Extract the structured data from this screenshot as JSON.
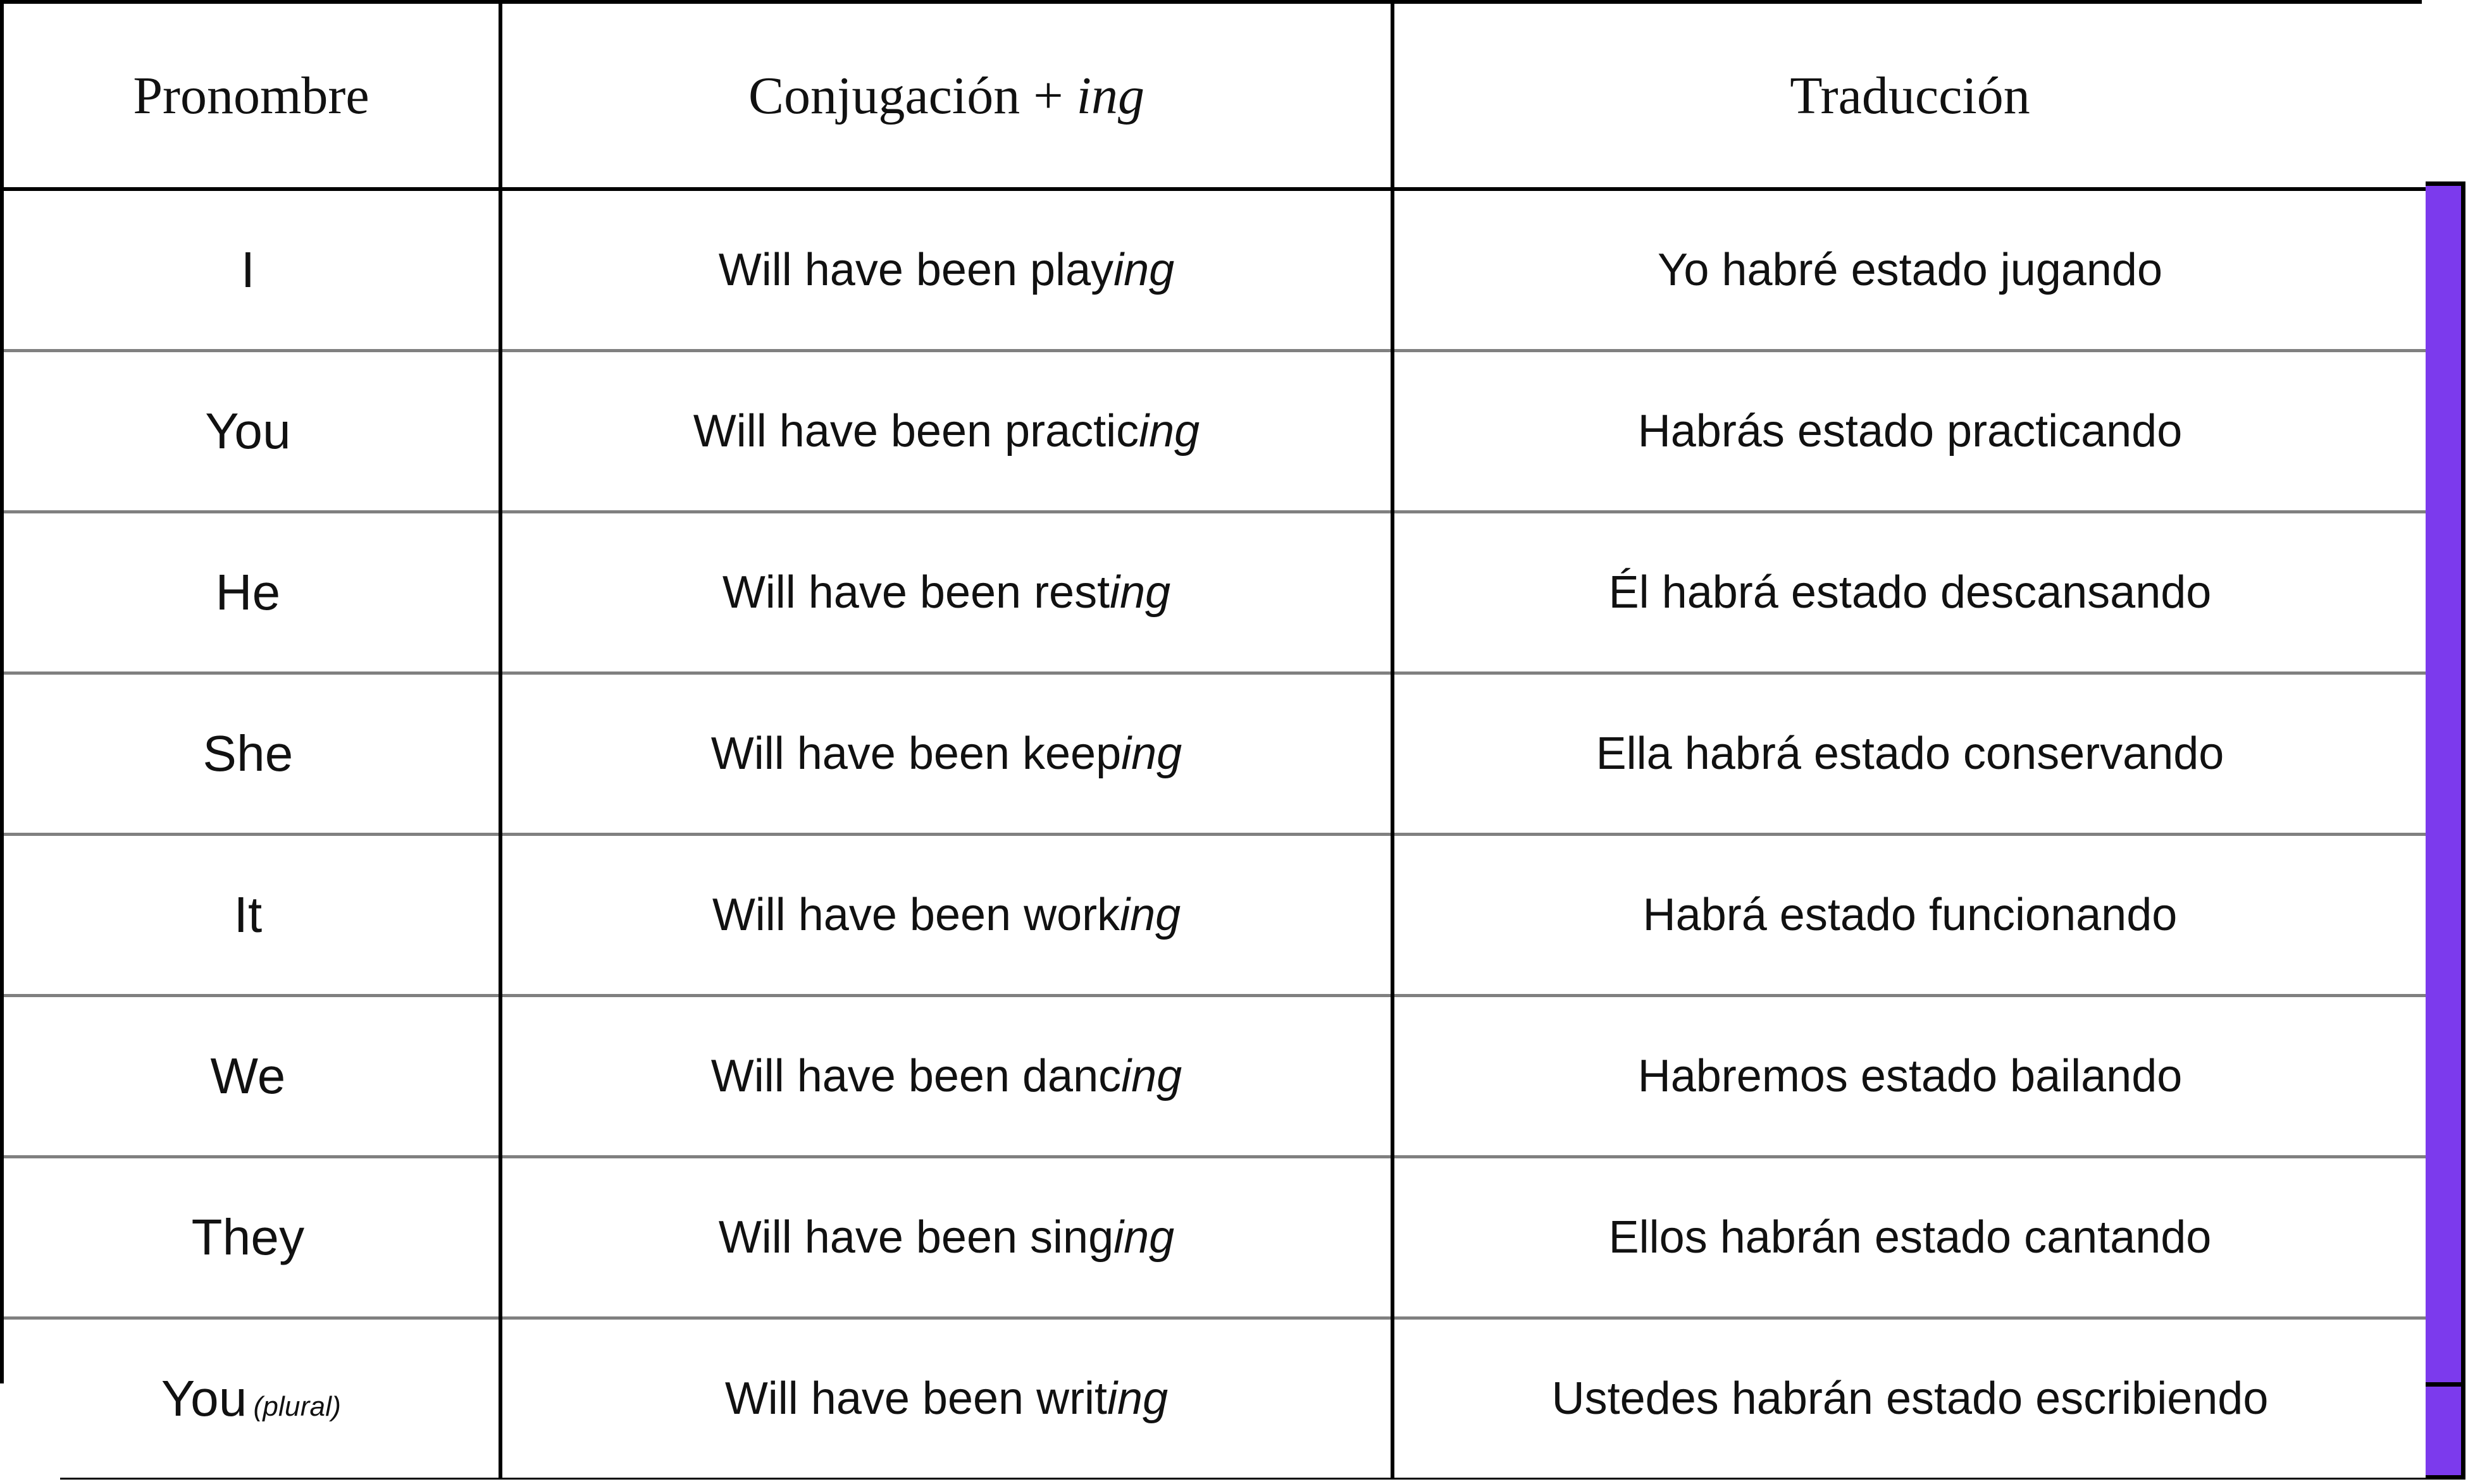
{
  "table": {
    "headers": {
      "pronoun": "Pronombre",
      "conjugation_prefix": "Conjugación + ",
      "conjugation_suffix": "ing",
      "translation": "Traducción"
    },
    "rows": [
      {
        "pronoun": "I",
        "pronoun_qualifier": "",
        "conjugation_stem": "Will have been play",
        "conjugation_ing": "ing",
        "translation": "Yo habré estado jugando"
      },
      {
        "pronoun": "You",
        "pronoun_qualifier": "",
        "conjugation_stem": "Will have been practic",
        "conjugation_ing": "ing",
        "translation": "Habrás estado practicando"
      },
      {
        "pronoun": "He",
        "pronoun_qualifier": "",
        "conjugation_stem": "Will have been rest",
        "conjugation_ing": "ing",
        "translation": "Él habrá estado descansando"
      },
      {
        "pronoun": "She",
        "pronoun_qualifier": "",
        "conjugation_stem": "Will have been keep",
        "conjugation_ing": "ing",
        "translation": "Ella habrá estado conservando"
      },
      {
        "pronoun": "It",
        "pronoun_qualifier": "",
        "conjugation_stem": "Will have been work",
        "conjugation_ing": "ing",
        "translation": "Habrá estado funcionando"
      },
      {
        "pronoun": "We",
        "pronoun_qualifier": "",
        "conjugation_stem": "Will have been danc",
        "conjugation_ing": "ing",
        "translation": "Habremos estado bailando"
      },
      {
        "pronoun": "They",
        "pronoun_qualifier": "",
        "conjugation_stem": "Will have been sing",
        "conjugation_ing": "ing",
        "translation": "Ellos habrán estado cantando"
      },
      {
        "pronoun": "You",
        "pronoun_qualifier": "(plural)",
        "conjugation_stem": "Will have been writ",
        "conjugation_ing": "ing",
        "translation": "Ustedes habrán estado escribiendo"
      }
    ]
  },
  "decor": {
    "accent_color": "#7c3aed",
    "border_color": "#000000",
    "row_divider_color": "#808080"
  }
}
